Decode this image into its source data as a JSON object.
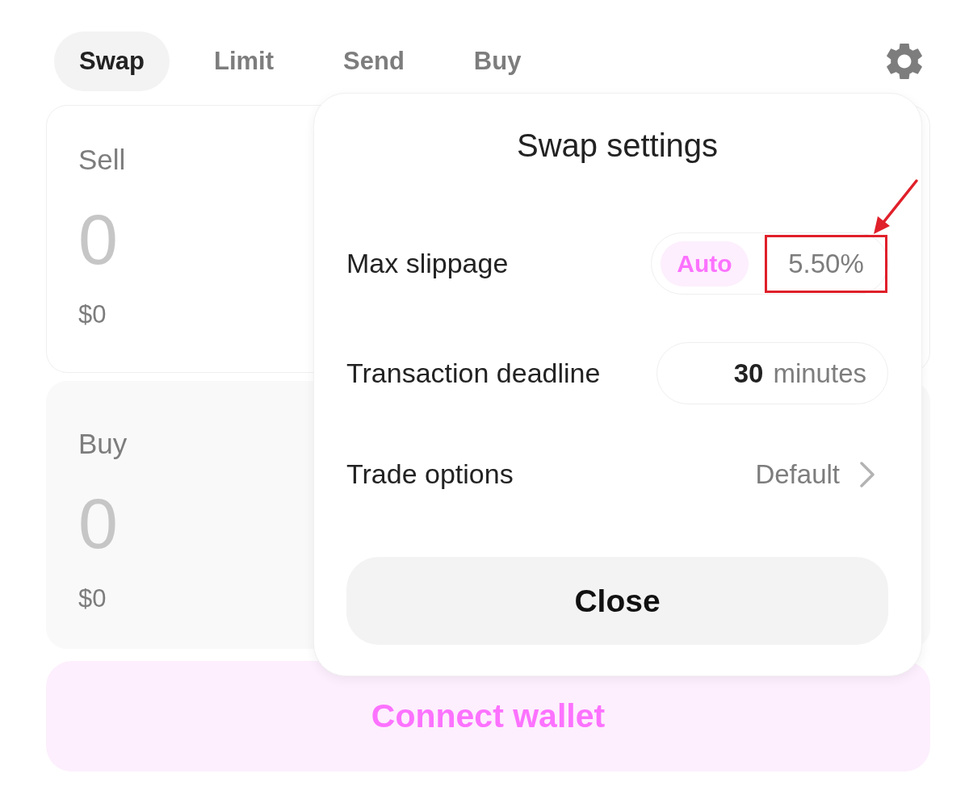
{
  "tabs": [
    {
      "label": "Swap",
      "selected": true
    },
    {
      "label": "Limit",
      "selected": false
    },
    {
      "label": "Send",
      "selected": false
    },
    {
      "label": "Buy",
      "selected": false
    }
  ],
  "panels": [
    {
      "kind": "sell",
      "label": "Sell",
      "placeholder": "0",
      "value": "$0"
    },
    {
      "kind": "buy",
      "label": "Buy",
      "placeholder": "0",
      "value": "$0"
    }
  ],
  "connect_button": {
    "label": "Connect wallet"
  },
  "settings_popover": {
    "title": "Swap settings",
    "rows": [
      {
        "kind": "slippage",
        "label": "Max slippage",
        "auto": {
          "label": "Auto",
          "selected": true
        },
        "placeholder": "5.50%",
        "highlighted": true
      },
      {
        "kind": "deadline",
        "label": "Transaction deadline",
        "value": "30",
        "unit": "minutes"
      },
      {
        "kind": "option",
        "label": "Trade options",
        "value": "Default"
      }
    ],
    "close_button": {
      "label": "Close"
    }
  }
}
